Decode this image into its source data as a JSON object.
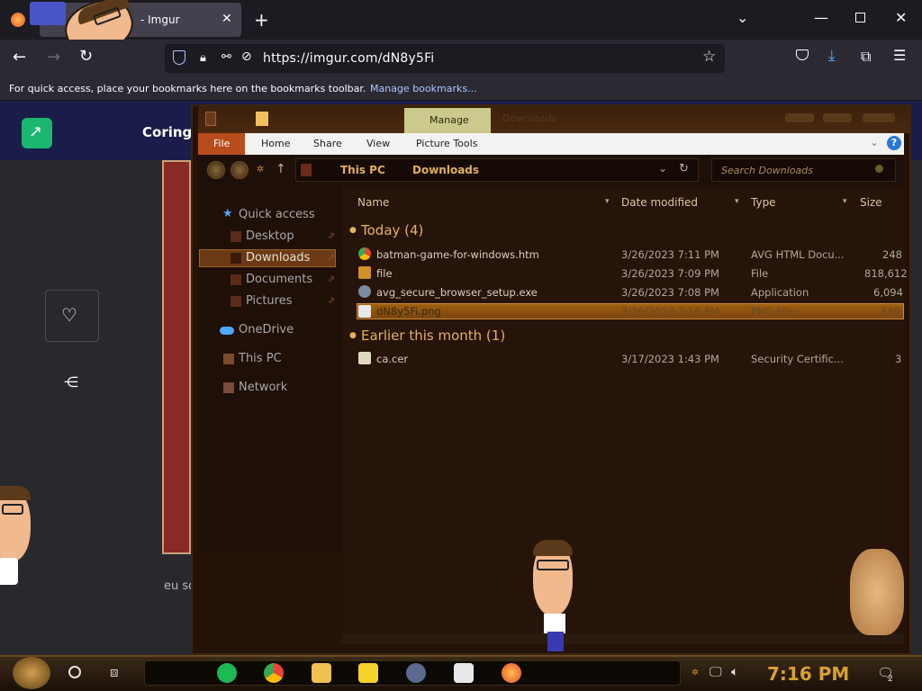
{
  "browser": {
    "tab_title": "- Imgur",
    "url": "https://imgur.com/dN8y5Fi",
    "bookmarks_prompt": "For quick access, place your bookmarks here on the bookmarks toolbar.",
    "manage_bookmarks": "Manage bookmarks..."
  },
  "imgur": {
    "title": "Coringa",
    "caption": "eu sofria agora eu so ria"
  },
  "explorer": {
    "manage_label": "Manage",
    "window_title": "Downloads",
    "ribbon_tabs": [
      "File",
      "Home",
      "Share",
      "View",
      "Picture Tools"
    ],
    "breadcrumb": [
      "This PC",
      "Downloads"
    ],
    "search_placeholder": "Search Downloads",
    "nav": {
      "quick_access": "Quick access",
      "desktop": "Desktop",
      "downloads": "Downloads",
      "documents": "Documents",
      "pictures": "Pictures",
      "onedrive": "OneDrive",
      "this_pc": "This PC",
      "network": "Network"
    },
    "columns": {
      "name": "Name",
      "date": "Date modified",
      "type": "Type",
      "size": "Size"
    },
    "groups": {
      "today": "Today (4)",
      "earlier": "Earlier this month (1)"
    },
    "files": [
      {
        "name": "batman-game-for-windows.htm",
        "date": "3/26/2023 7:11 PM",
        "type": "AVG HTML Docu...",
        "size": "248"
      },
      {
        "name": "file",
        "date": "3/26/2023 7:09 PM",
        "type": "File",
        "size": "818,612"
      },
      {
        "name": "avg_secure_browser_setup.exe",
        "date": "3/26/2023 7:08 PM",
        "type": "Application",
        "size": "6,094"
      },
      {
        "name": "dN8y5Fi.png",
        "date": "3/26/2023 7:16 PM",
        "type": "PNG File",
        "size": "380"
      },
      {
        "name": "ca.cer",
        "date": "3/17/2023 1:43 PM",
        "type": "Security Certific...",
        "size": "3"
      }
    ]
  },
  "taskbar": {
    "clock": "7:16 PM",
    "notification_count": "2"
  },
  "colors": {
    "accent_gold": "#e0b060",
    "file_tab": "#b84c1a",
    "selection": "#a06010"
  }
}
